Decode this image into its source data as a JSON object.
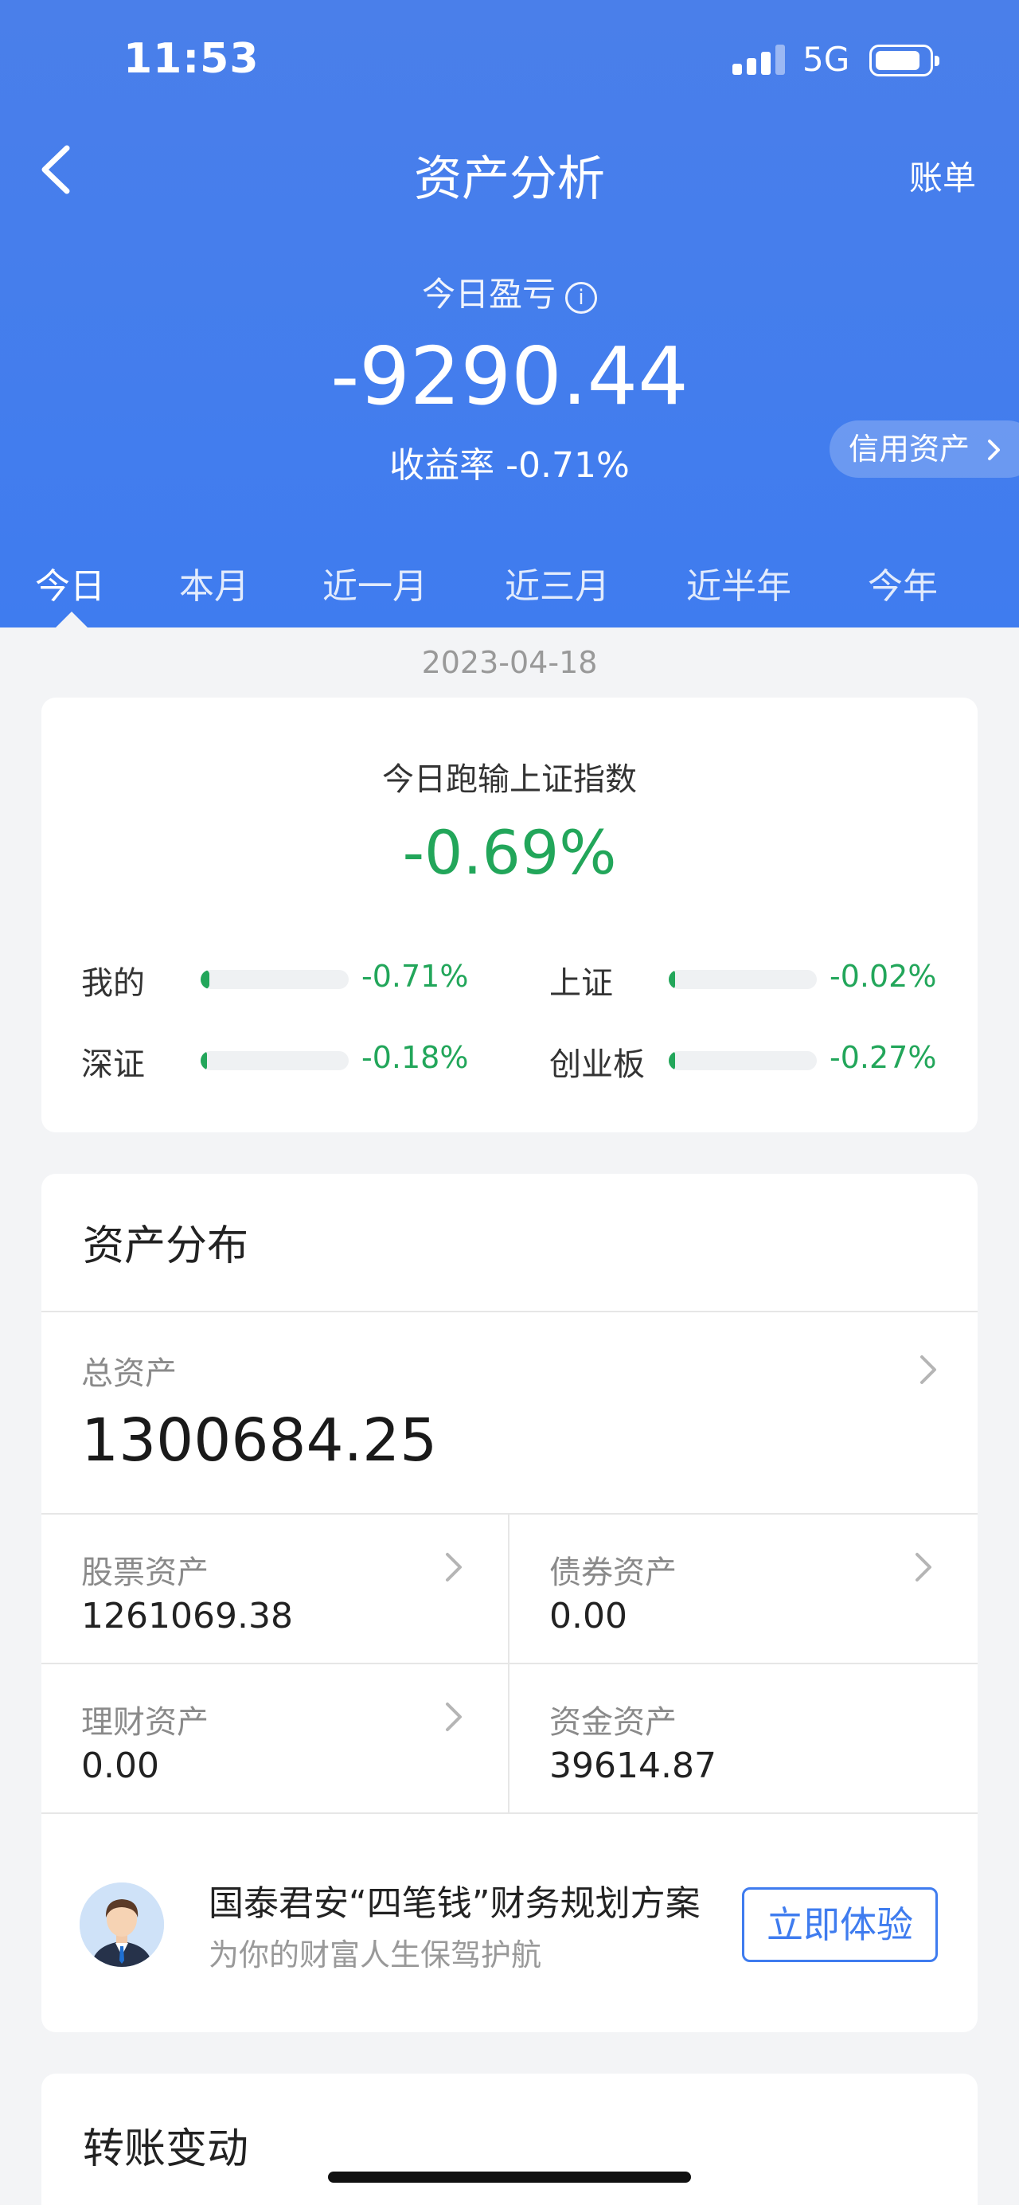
{
  "status_bar": {
    "time": "11:53",
    "network": "5G"
  },
  "header": {
    "title": "资产分析",
    "bill_link": "账单",
    "pnl_label": "今日盈亏",
    "pnl_value": "-9290.44",
    "rate_text": "收益率 -0.71%",
    "credit_pill": "信用资产"
  },
  "tabs": [
    "今日",
    "本月",
    "近一月",
    "近三月",
    "近半年",
    "今年"
  ],
  "date": "2023-04-18",
  "compare": {
    "title": "今日跑输上证指数",
    "value": "-0.69%",
    "items": [
      {
        "label": "我的",
        "value": "-0.71%",
        "fill": 0.06
      },
      {
        "label": "上证",
        "value": "-0.02%",
        "fill": 0.01
      },
      {
        "label": "深证",
        "value": "-0.18%",
        "fill": 0.015
      },
      {
        "label": "创业板",
        "value": "-0.27%",
        "fill": 0.025
      }
    ],
    "accent": "#22a65a"
  },
  "assets": {
    "title": "资产分布",
    "total_label": "总资产",
    "total_value": "1300684.25",
    "stock_label": "股票资产",
    "stock_value": "1261069.38",
    "bond_label": "债券资产",
    "bond_value": "0.00",
    "wealth_label": "理财资产",
    "wealth_value": "0.00",
    "cash_label": "资金资产",
    "cash_value": "39614.87"
  },
  "plan": {
    "title": "国泰君安“四笔钱”财务规划方案",
    "subtitle": "为你的财富人生保驾护航",
    "button": "立即体验"
  },
  "transfer": {
    "title": "转账变动"
  },
  "colors": {
    "primary": "#3f7cef",
    "gain_loss_green": "#22a65a"
  }
}
